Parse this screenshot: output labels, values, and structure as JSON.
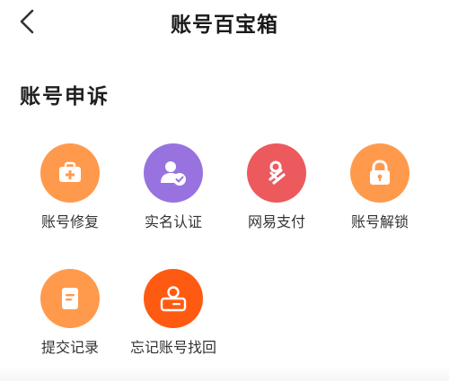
{
  "header": {
    "title": "账号百宝箱",
    "back_icon": "chevron-left-icon"
  },
  "section": {
    "title": "账号申诉"
  },
  "tools": [
    {
      "label": "账号修复",
      "icon": "medical-kit-icon",
      "color": "#FF9A4D"
    },
    {
      "label": "实名认证",
      "icon": "user-verified-icon",
      "color": "#9873DF"
    },
    {
      "label": "网易支付",
      "icon": "netease-pay-icon",
      "color": "#EC5A5E"
    },
    {
      "label": "账号解锁",
      "icon": "unlock-icon",
      "color": "#FF9A4D"
    },
    {
      "label": "提交记录",
      "icon": "document-icon",
      "color": "#FF9A4D"
    },
    {
      "label": "忘记账号找回",
      "icon": "id-card-icon",
      "color": "#FF5A12"
    }
  ]
}
